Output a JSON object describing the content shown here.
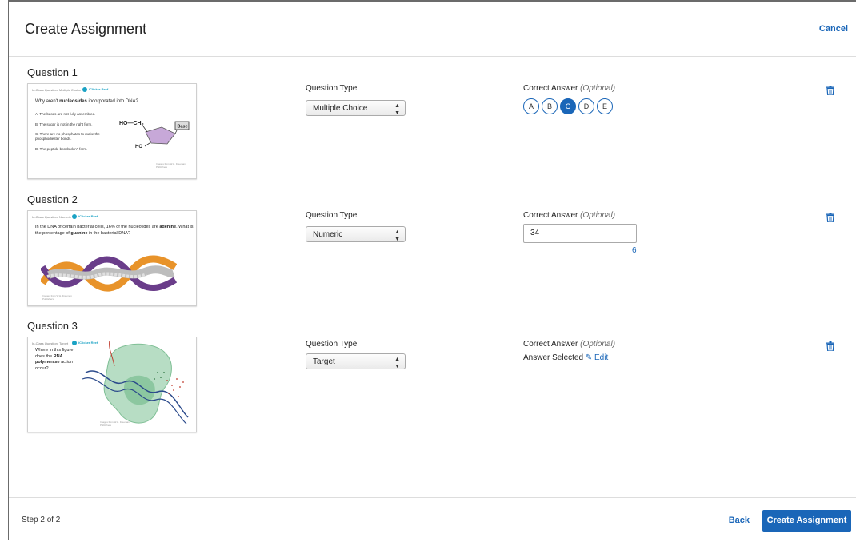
{
  "header": {
    "title": "Create Assignment",
    "cancel_label": "Cancel"
  },
  "labels": {
    "question_type": "Question Type",
    "correct_answer": "Correct Answer",
    "optional": "(Optional)"
  },
  "questions": [
    {
      "title": "Question 1",
      "type": "Multiple Choice",
      "choices": [
        "A",
        "B",
        "C",
        "D",
        "E"
      ],
      "selected_choice": "C",
      "thumbnail": {
        "header": "In-Class Question: Multiple Choice",
        "logo": "iClicker Reef",
        "question_parts": [
          "Why aren't ",
          "nucleosides",
          " incorporated into DNA?"
        ],
        "options": [
          "A.  The bases are not fully assembled.",
          "B.  The sugar is not in the right form.",
          "C.  There are no phosphates to make the phosphodiester bonds.",
          "D.  The peptide bonds don't form."
        ],
        "diagram_ho_ch2": "HO—CH₂",
        "diagram_base": "Base",
        "diagram_ho": "HO",
        "credit": "Images from W.H. Freeman Publishers"
      }
    },
    {
      "title": "Question 2",
      "type": "Numeric",
      "answer_value": "34",
      "answer_extra": "6",
      "thumbnail": {
        "header": "In-Class Question: Numeric",
        "logo": "iClicker Reef",
        "question_parts": [
          "In the DNA of certain bacterial cells, 16% of the nucleotides are ",
          "adenine",
          ". What is the percentage of ",
          "guanine",
          " in the bacterial DNA?"
        ],
        "credit": "Images from W.H. Freeman Publishers"
      }
    },
    {
      "title": "Question 3",
      "type": "Target",
      "answer_status": "Answer Selected",
      "edit_label": "Edit",
      "thumbnail": {
        "header": "In-Class Question: Target",
        "logo": "iClicker Reef",
        "question_parts": [
          "Where in this figure does the ",
          "RNA polymerase",
          " action occur?"
        ],
        "credit": "Images from W.H. Freeman Publishers"
      }
    }
  ],
  "footer": {
    "step": "Step 2 of 2",
    "back_label": "Back",
    "create_label": "Create Assignment"
  },
  "colors": {
    "accent": "#1a66b8",
    "logo": "#1aa2c4"
  },
  "icons": {
    "trash": "trash-icon",
    "edit": "pencil-icon",
    "select": "updown-arrows-icon"
  }
}
